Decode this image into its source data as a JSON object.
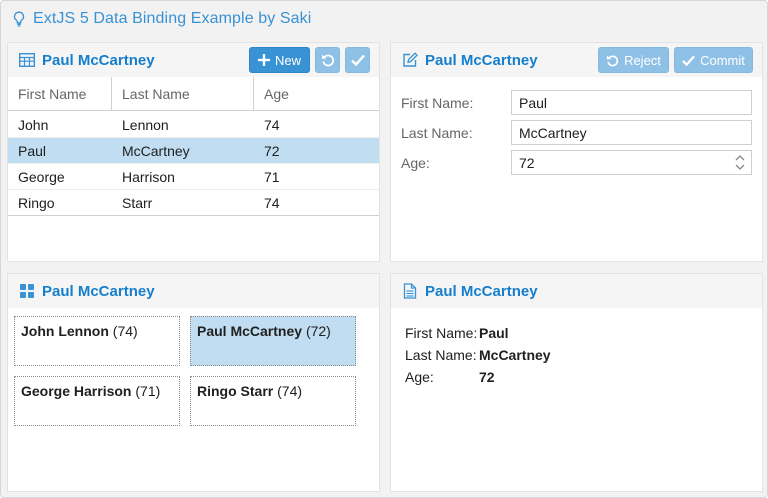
{
  "window": {
    "title": "ExtJS 5 Data Binding Example by Saki"
  },
  "grid_panel": {
    "title": "Paul McCartney",
    "new_label": "New",
    "columns": [
      "First Name",
      "Last Name",
      "Age"
    ],
    "rows": [
      {
        "first": "John",
        "last": "Lennon",
        "age": "74"
      },
      {
        "first": "Paul",
        "last": "McCartney",
        "age": "72"
      },
      {
        "first": "George",
        "last": "Harrison",
        "age": "71"
      },
      {
        "first": "Ringo",
        "last": "Starr",
        "age": "74"
      }
    ]
  },
  "form_panel": {
    "title": "Paul McCartney",
    "reject_label": "Reject",
    "commit_label": "Commit",
    "first_label": "First Name:",
    "last_label": "Last Name:",
    "age_label": "Age:",
    "first_value": "Paul",
    "last_value": "McCartney",
    "age_value": "72"
  },
  "dataview_panel": {
    "title": "Paul McCartney",
    "items": [
      {
        "name": "John Lennon",
        "age": "(74)"
      },
      {
        "name": "Paul McCartney",
        "age": "(72)"
      },
      {
        "name": "George Harrison",
        "age": "(71)"
      },
      {
        "name": "Ringo Starr",
        "age": "(74)"
      }
    ]
  },
  "details_panel": {
    "title": "Paul McCartney",
    "first_label": "First Name:",
    "last_label": "Last Name:",
    "age_label": "Age:",
    "first_value": "Paul",
    "last_value": "McCartney",
    "age_value": "72"
  },
  "colors": {
    "accent": "#157fcc",
    "button": "#3892d4",
    "button_disabled": "#8fc1e6",
    "selection": "#c1ddf1"
  }
}
